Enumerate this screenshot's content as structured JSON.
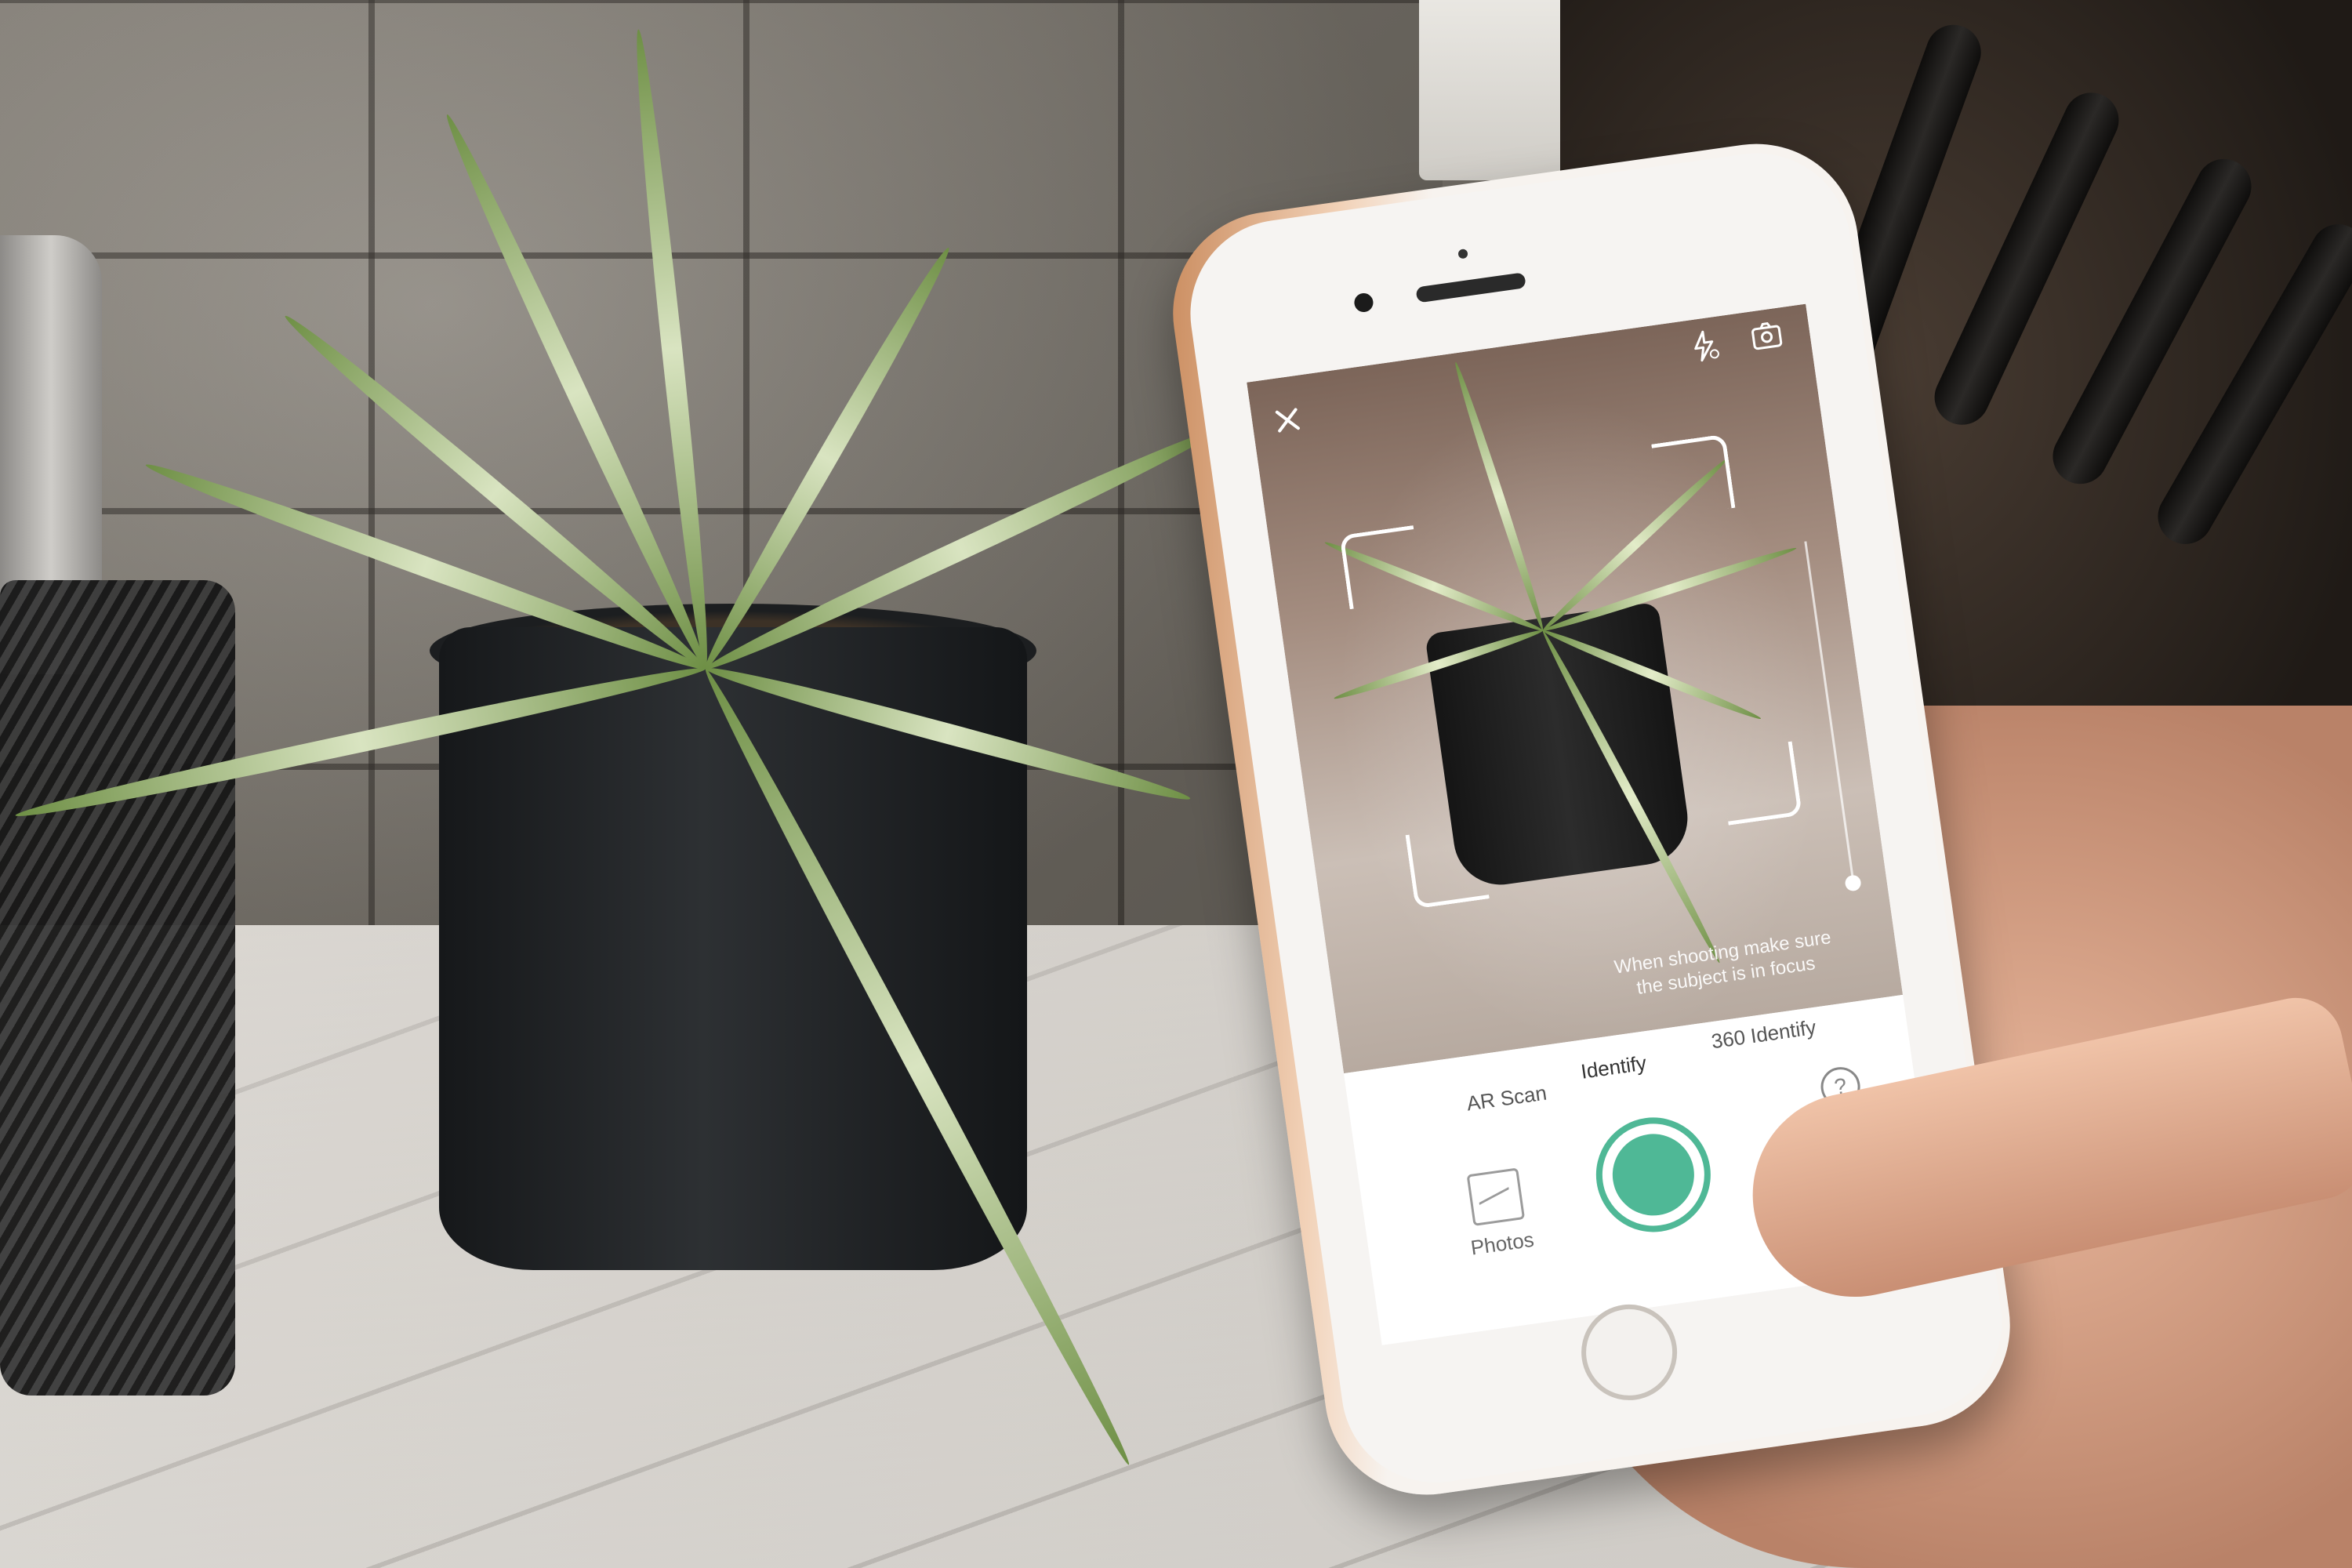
{
  "screen": {
    "top_bar": {
      "close_icon": "close-icon",
      "flash_icon": "flash-off-icon",
      "switch_camera_icon": "switch-camera-icon"
    },
    "hint": {
      "line1": "When shooting make sure",
      "line2": "the subject is in focus"
    },
    "modes": [
      {
        "label": "AR Scan"
      },
      {
        "label": "Identify"
      },
      {
        "label": "360 Identify"
      }
    ],
    "photos_label": "Photos",
    "help_glyph": "?",
    "accent_color": "#4fb896"
  }
}
